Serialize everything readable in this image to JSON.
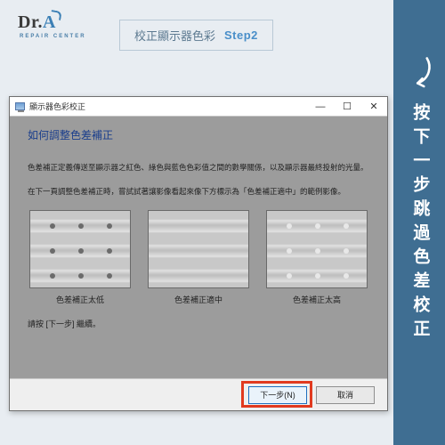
{
  "logo": {
    "prefix": "Dr.",
    "accent": "A",
    "sub": "REPAIR CENTER"
  },
  "badge": {
    "title": "校正顯示器色彩",
    "step": "Step2"
  },
  "strip": {
    "text": "按下一步跳過色差校正"
  },
  "window": {
    "title": "顯示器色彩校正",
    "controls": {
      "min": "—",
      "max": "☐",
      "close": "✕"
    },
    "heading": "如何調整色差補正",
    "para1": "色差補正定義傳送至顯示器之紅色、綠色與藍色色彩值之間的數學關係，以及顯示器最終投射的光量。",
    "para2": "在下一頁調整色差補正時，嘗試試著讓影像看起來像下方標示為「色差補正適中」的範例影像。",
    "samples": [
      {
        "caption": "色差補正太低"
      },
      {
        "caption": "色差補正適中"
      },
      {
        "caption": "色差補正太高"
      }
    ],
    "hint": "請按 [下一步] 繼續。",
    "buttons": {
      "next": "下一步(N)",
      "cancel": "取消"
    }
  }
}
